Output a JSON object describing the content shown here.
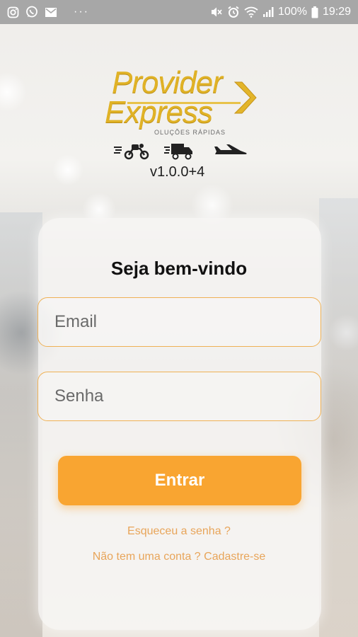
{
  "status_bar": {
    "battery_percent": "100%",
    "time": "19:29",
    "more_indicator": "···",
    "left_icons": [
      "instagram-icon",
      "whatsapp-icon",
      "mail-icon"
    ],
    "right_icons": [
      "mute-icon",
      "alarm-icon",
      "wifi-icon",
      "signal-icon",
      "battery-icon"
    ]
  },
  "logo": {
    "line1": "Provider",
    "line2": "Express",
    "tagline": "OLUÇÕES RÁPIDAS",
    "vehicles": [
      "motorcycle-icon",
      "truck-icon",
      "airplane-icon"
    ],
    "brand_color": "#e0b226"
  },
  "version": "v1.0.0+4",
  "login": {
    "title": "Seja bem-vindo",
    "email_placeholder": "Email",
    "password_placeholder": "Senha",
    "submit_label": "Entrar",
    "forgot_link": "Esqueceu a senha ?",
    "register_link": "Não tem uma conta ? Cadastre-se",
    "accent_color": "#f9a531"
  }
}
